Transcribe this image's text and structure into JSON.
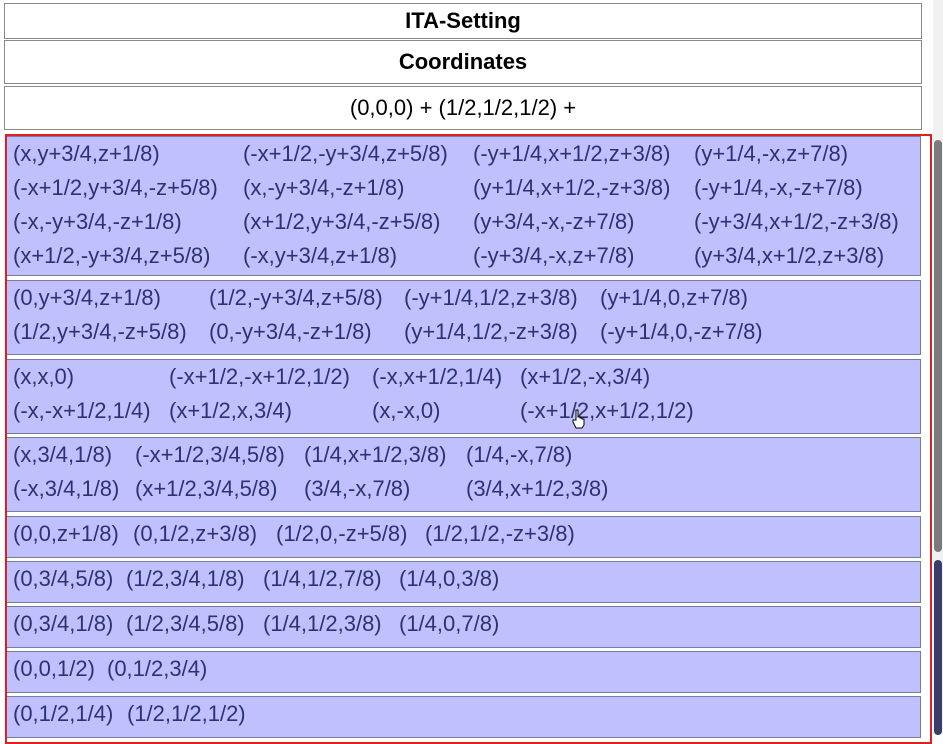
{
  "table": {
    "setting_header": "ITA-Setting",
    "coordinates_header": "Coordinates",
    "centering": "(0,0,0) + (1/2,1/2,1/2) +"
  },
  "wyckoff_groups": [
    {
      "lines": [
        [
          "(x,y+3/4,z+1/8)",
          "(-x+1/2,-y+3/4,z+5/8)",
          "(-y+1/4,x+1/2,z+3/8)",
          "(y+1/4,-x,z+7/8)"
        ],
        [
          "(-x+1/2,y+3/4,-z+5/8)",
          "(x,-y+3/4,-z+1/8)",
          "(y+1/4,x+1/2,-z+3/8)",
          "(-y+1/4,-x,-z+7/8)"
        ],
        [
          "(-x,-y+3/4,-z+1/8)",
          "(x+1/2,y+3/4,-z+5/8)",
          "(y+3/4,-x,-z+7/8)",
          "(-y+3/4,x+1/2,-z+3/8)"
        ],
        [
          "(x+1/2,-y+3/4,z+5/8)",
          "(-x,y+3/4,z+1/8)",
          "(-y+3/4,-x,z+7/8)",
          "(y+3/4,x+1/2,z+3/8)"
        ]
      ]
    },
    {
      "lines": [
        [
          "(0,y+3/4,z+1/8)",
          "(1/2,-y+3/4,z+5/8)",
          "(-y+1/4,1/2,z+3/8)",
          "(y+1/4,0,z+7/8)"
        ],
        [
          "(1/2,y+3/4,-z+5/8)",
          "(0,-y+3/4,-z+1/8)",
          "(y+1/4,1/2,-z+3/8)",
          "(-y+1/4,0,-z+7/8)"
        ]
      ]
    },
    {
      "lines": [
        [
          "(x,x,0)",
          "(-x+1/2,-x+1/2,1/2)",
          "(-x,x+1/2,1/4)",
          "(x+1/2,-x,3/4)"
        ],
        [
          "(-x,-x+1/2,1/4)",
          "(x+1/2,x,3/4)",
          "(x,-x,0)",
          "(-x+1/2,x+1/2,1/2)"
        ]
      ]
    },
    {
      "lines": [
        [
          "(x,3/4,1/8)",
          "(-x+1/2,3/4,5/8)",
          "(1/4,x+1/2,3/8)",
          "(1/4,-x,7/8)"
        ],
        [
          "(-x,3/4,1/8)",
          "(x+1/2,3/4,5/8)",
          "(3/4,-x,7/8)",
          "(3/4,x+1/2,3/8)"
        ]
      ]
    },
    {
      "lines": [
        [
          "(0,0,z+1/8)",
          "(0,1/2,z+3/8)",
          "(1/2,0,-z+5/8)",
          "(1/2,1/2,-z+3/8)"
        ]
      ]
    },
    {
      "lines": [
        [
          "(0,3/4,5/8)",
          "(1/2,3/4,1/8)",
          "(1/4,1/2,7/8)",
          "(1/4,0,3/8)"
        ]
      ]
    },
    {
      "lines": [
        [
          "(0,3/4,1/8)",
          "(1/2,3/4,5/8)",
          "(1/4,1/2,3/8)",
          "(1/4,0,7/8)"
        ]
      ]
    },
    {
      "lines": [
        [
          "(0,0,1/2)",
          "(0,1/2,3/4)"
        ]
      ]
    },
    {
      "lines": [
        [
          "(0,1/2,1/4)",
          "(1/2,1/2,1/2)"
        ]
      ]
    }
  ],
  "colors": {
    "group_background": "#c0c0ff",
    "coordinate_text": "#2c3370",
    "selection_border": "#e02020"
  },
  "cursor_icon": "hand-pointer-icon"
}
